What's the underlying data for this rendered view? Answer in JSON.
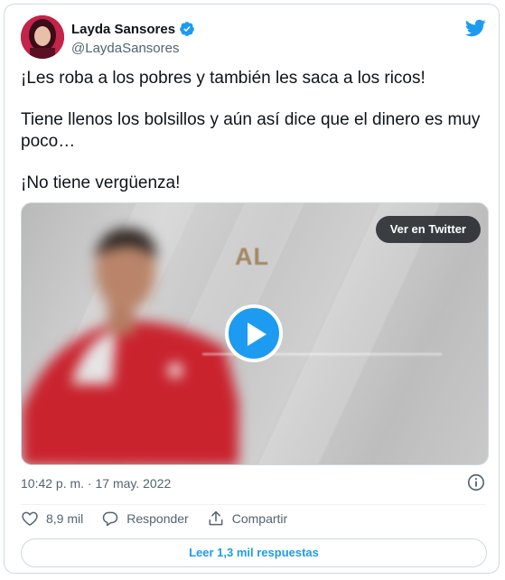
{
  "author": {
    "display_name": "Layda Sansores",
    "handle": "@LaydaSansores",
    "verified": true,
    "avatar_icon": "profile-photo"
  },
  "tweet": {
    "paragraphs": [
      "¡Les roba a los pobres y también les saca a los ricos!",
      "Tiene llenos los bolsillos y aún así dice que el dinero es muy poco…",
      "¡No tiene vergüenza!"
    ],
    "timestamp": "10:42 p. m. · 17 may. 2022"
  },
  "media": {
    "overlay_text": "AL",
    "view_button_label": "Ver en Twitter",
    "play_icon": "play-icon"
  },
  "actions": {
    "like_count": "8,9 mil",
    "reply_label": "Responder",
    "share_label": "Compartir"
  },
  "read_replies_label": "Leer 1,3 mil respuestas",
  "colors": {
    "accent": "#1d9bf0",
    "text_primary": "#0f1419",
    "text_secondary": "#536471",
    "border": "#cfd9de"
  }
}
